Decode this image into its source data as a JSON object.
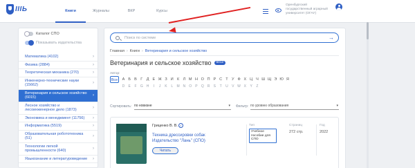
{
  "header": {
    "logo_text": "IIIЬ",
    "nav": [
      {
        "label": "Книги",
        "active": true
      },
      {
        "label": "Журналы",
        "active": false
      },
      {
        "label": "ВКР",
        "active": false
      },
      {
        "label": "Курсы",
        "active": false
      }
    ],
    "org_name": "Оренбургский государственный аграрный университет (ОГАУ)"
  },
  "sidebar": {
    "toggles": [
      {
        "label": "Каталог СПО",
        "on": false
      },
      {
        "label": "Показывать издательства",
        "on": true
      }
    ],
    "categories": [
      {
        "label": "Математика (4102)",
        "active": false
      },
      {
        "label": "Физика (2884)",
        "active": false
      },
      {
        "label": "Теоретическая механика (270)",
        "active": false
      },
      {
        "label": "Инженерно-технические науки (15662)",
        "active": false
      },
      {
        "label": "Ветеринария и сельское хозяйство (6015)",
        "active": true
      },
      {
        "label": "Лесное хозяйство и лесоинженерное дело (1873)",
        "active": false
      },
      {
        "label": "Экономика и менеджмент (11756)",
        "active": false
      },
      {
        "label": "Информатика (5519)",
        "active": false
      },
      {
        "label": "Образовательная робототехника (51)",
        "active": false
      },
      {
        "label": "Технологии легкой промышленности (640)",
        "active": false
      },
      {
        "label": "Языкознание и литературоведение",
        "active": false
      }
    ]
  },
  "main": {
    "search": {
      "placeholder": "Поиск по системе",
      "value": ""
    },
    "breadcrumbs": [
      "Главная",
      "Книги",
      "Ветеринария и сельское хозяйство"
    ],
    "title": "Ветеринария и сельское хозяйство",
    "count": "6012",
    "author_label": "Автор:",
    "alphabet_ru": [
      "Все",
      "А",
      "Б",
      "В",
      "Г",
      "Д",
      "Е",
      "Ж",
      "З",
      "И",
      "К",
      "Л",
      "М",
      "Н",
      "О",
      "П",
      "Р",
      "С",
      "Т",
      "У",
      "Ф",
      "Х",
      "Ц",
      "Ч",
      "Ш",
      "Щ",
      "Э",
      "Ю",
      "Я"
    ],
    "alphabet_lat": [
      "D",
      "E",
      "F",
      "G",
      "H",
      "I",
      "J",
      "K",
      "L",
      "M",
      "N",
      "O",
      "P",
      "Q",
      "R",
      "S",
      "T",
      "U",
      "V",
      "W",
      "X",
      "Y",
      "Z"
    ],
    "sort_label": "Сортировать:",
    "sort_value": "по новизне",
    "filter_label": "Фильтр:",
    "filter_value": "по уровню образования",
    "book": {
      "author": "Гриценко В. В.",
      "title": "Техника дрессировки собак",
      "publisher": "Издательство \"Лань\" (СПО)",
      "read_label": "Читать",
      "type_header": "Тип",
      "type_value": "Учебное пособие для СПО",
      "pages_header": "Страниц",
      "pages_value": "272 стр.",
      "year_header": "Год",
      "year_value": "2022"
    }
  },
  "colors": {
    "accent": "#2f5fc4",
    "active_bg": "#2f6fd2",
    "annotation": "#e02020"
  }
}
